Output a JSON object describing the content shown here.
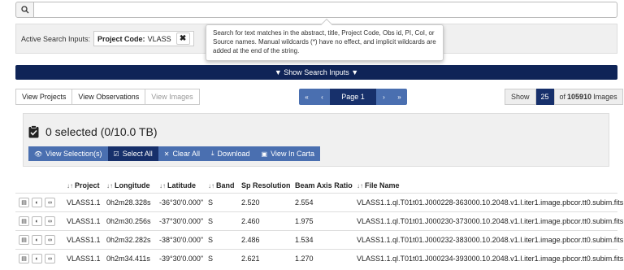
{
  "search": {
    "placeholder": "",
    "value": ""
  },
  "active_inputs": {
    "label": "Active Search Inputs:",
    "chips": [
      {
        "key": "Project Code:",
        "value": "VLASS"
      }
    ]
  },
  "tooltip": {
    "text": "Search for text matches in the abstract, title, Project Code, Obs id, PI, CoI, or Source names. Manual wildcards (*) have no effect, and implicit wildcards are added at the end of the string."
  },
  "show_inputs_label": "▼ Show Search Inputs ▼",
  "view_tabs": [
    {
      "label": "View Projects"
    },
    {
      "label": "View Observations"
    },
    {
      "label": "View Images"
    }
  ],
  "pager": {
    "first": "«",
    "prev": "‹",
    "current": "Page 1",
    "next": "›",
    "last": "»"
  },
  "page_size": {
    "show_label": "Show",
    "value": "25",
    "of_label": "of",
    "total": "105910",
    "unit": "Images"
  },
  "selection": {
    "title": "0 selected (0/10.0 TB)",
    "buttons": [
      {
        "label": "View Selection(s)",
        "icon": "eye-icon"
      },
      {
        "label": "Select All",
        "icon": "check-square-icon"
      },
      {
        "label": "Clear All",
        "icon": "x-icon"
      },
      {
        "label": "Download",
        "icon": "download-icon"
      },
      {
        "label": "View In Carta",
        "icon": "image-icon"
      }
    ]
  },
  "table": {
    "sort_glyph": "↓↑",
    "columns": {
      "project": "Project",
      "longitude": "Longitude",
      "latitude": "Latitude",
      "band": "Band",
      "sp_resolution": "Sp Resolution",
      "beam_axis_ratio": "Beam Axis Ratio",
      "file_name": "File Name"
    },
    "rows": [
      {
        "project": "VLASS1.1",
        "longitude": "0h2m28.328s",
        "latitude": "-36°30'0.000\"",
        "band": "S",
        "sp_resolution": "2.520",
        "beam_axis_ratio": "2.554",
        "file_name": "VLASS1.1.ql.T01t01.J000228-363000.10.2048.v1.I.iter1.image.pbcor.tt0.subim.fits"
      },
      {
        "project": "VLASS1.1",
        "longitude": "0h2m30.256s",
        "latitude": "-37°30'0.000\"",
        "band": "S",
        "sp_resolution": "2.460",
        "beam_axis_ratio": "1.975",
        "file_name": "VLASS1.1.ql.T01t01.J000230-373000.10.2048.v1.I.iter1.image.pbcor.tt0.subim.fits"
      },
      {
        "project": "VLASS1.1",
        "longitude": "0h2m32.282s",
        "latitude": "-38°30'0.000\"",
        "band": "S",
        "sp_resolution": "2.486",
        "beam_axis_ratio": "1.534",
        "file_name": "VLASS1.1.ql.T01t01.J000232-383000.10.2048.v1.I.iter1.image.pbcor.tt0.subim.fits"
      },
      {
        "project": "VLASS1.1",
        "longitude": "0h2m34.411s",
        "latitude": "-39°30'0.000\"",
        "band": "S",
        "sp_resolution": "2.621",
        "beam_axis_ratio": "1.270",
        "file_name": "VLASS1.1.ql.T01t01.J000234-393000.10.2048.v1.I.iter1.image.pbcor.tt0.subim.fits"
      }
    ],
    "row_actions": [
      "clipboard-icon",
      "globe-icon",
      "link-icon"
    ]
  }
}
